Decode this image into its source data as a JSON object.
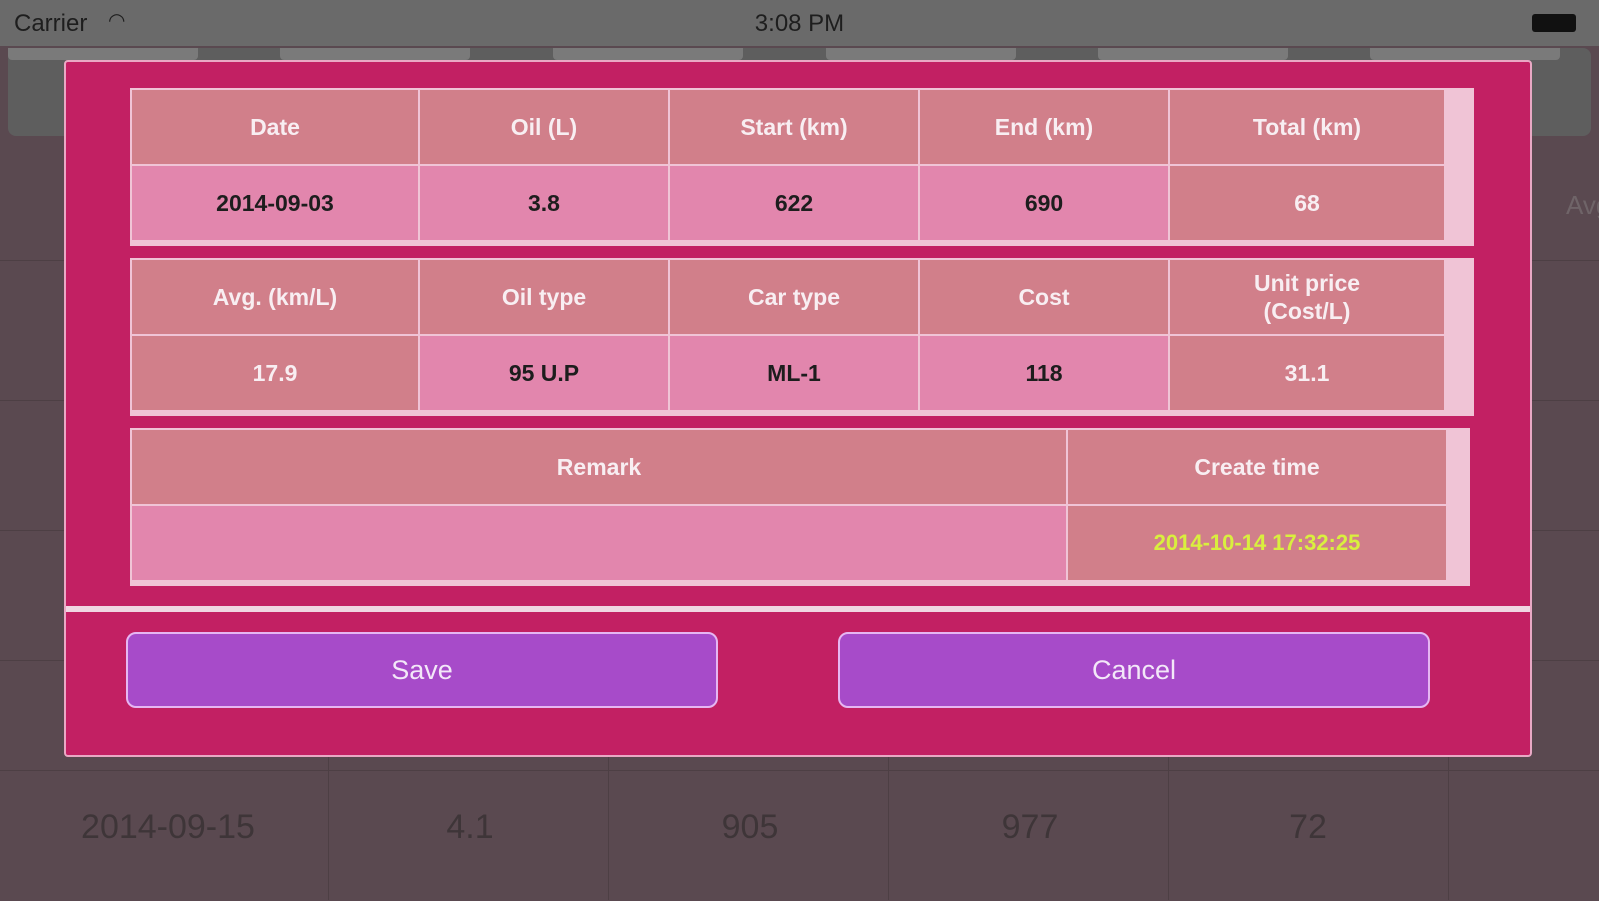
{
  "status_bar": {
    "carrier": "Carrier",
    "time": "3:08 PM"
  },
  "background": {
    "avg_label": "Avg.",
    "last_row": [
      "2014-09-15",
      "4.1",
      "905",
      "977",
      "72"
    ]
  },
  "dialog": {
    "table1": {
      "headers": [
        "Date",
        "Oil (L)",
        "Start (km)",
        "End (km)",
        "Total (km)"
      ],
      "values": [
        "2014-09-03",
        "3.8",
        "622",
        "690",
        "68"
      ]
    },
    "table2": {
      "headers": [
        "Avg. (km/L)",
        "Oil type",
        "Car type",
        "Cost",
        "Unit price\n(Cost/L)"
      ],
      "values": [
        "17.9",
        "95 U.P",
        "ML-1",
        "118",
        "31.1"
      ]
    },
    "table3": {
      "headers": [
        "Remark",
        "Create time"
      ],
      "remark_value": "",
      "create_time": "2014-10-14 17:32:25"
    },
    "buttons": {
      "save": "Save",
      "cancel": "Cancel"
    }
  },
  "colors": {
    "dialog_bg": "#c22063",
    "header_cell": "#d17f8a",
    "value_cell": "#e286ad",
    "button": "#a74bc9",
    "create_time_text": "#d9ef3e"
  }
}
